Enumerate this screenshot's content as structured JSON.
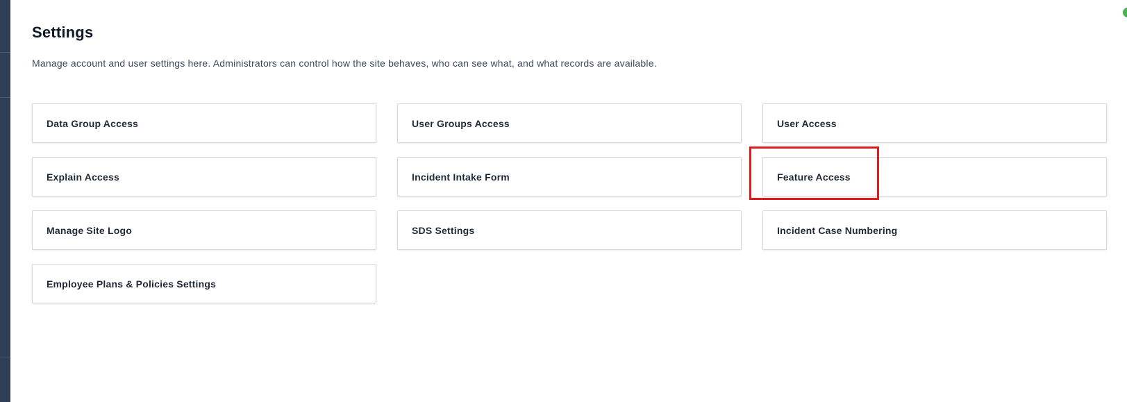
{
  "page": {
    "title": "Settings",
    "description": "Manage account and user settings here. Administrators can control how the site behaves, who can see what, and what records are available."
  },
  "cards": [
    "Data Group Access",
    "User Groups Access",
    "User Access",
    "Explain Access",
    "Incident Intake Form",
    "Feature Access",
    "Manage Site Logo",
    "SDS Settings",
    "Incident Case Numbering",
    "Employee Plans & Policies Settings"
  ],
  "colors": {
    "sidebar": "#2e3e56",
    "highlight": "#e01b1b",
    "status_dot": "#4caf50"
  }
}
